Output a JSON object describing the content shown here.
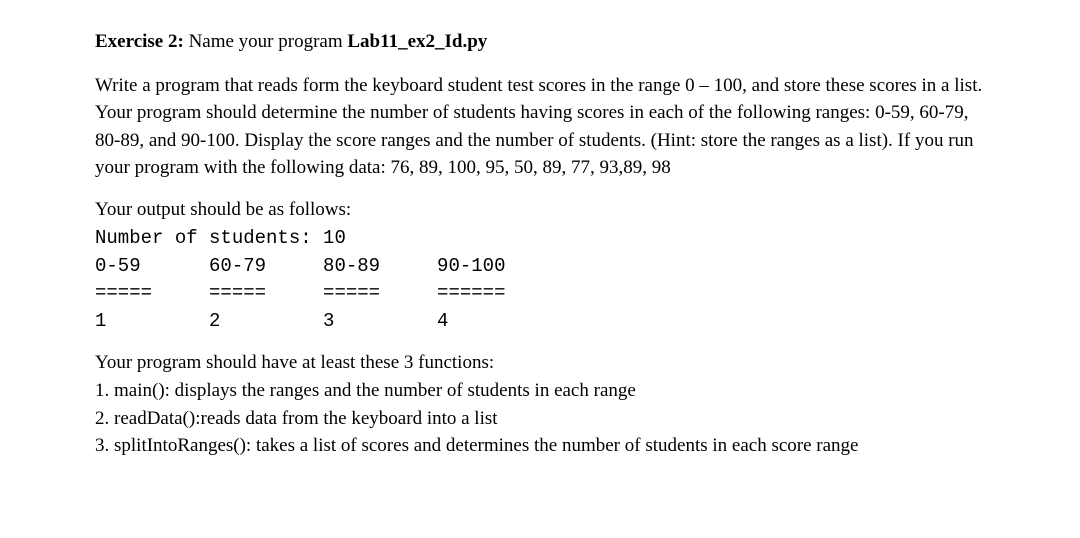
{
  "heading": {
    "prefix": "Exercise 2:",
    "mid": " Name your program ",
    "filename": "Lab11_ex2_Id.py"
  },
  "paragraph1": "Write a program that reads form the keyboard student test scores in the range 0 – 100, and store these scores in a list. Your program should determine the number of students having scores in each of the following ranges: 0-59, 60-79, 80-89, and 90-100. Display the score ranges and the number of students. (Hint: store the ranges as a list). If you run your program with the following data: 76, 89, 100, 95, 50, 89, 77, 93,89, 98",
  "output_intro": "Your output should be as follows:",
  "output_block": "Number of students: 10\n0-59      60-79     80-89     90-100\n=====     =====     =====     ======\n1         2         3         4",
  "functions_intro": "Your program should have at least these 3 functions:",
  "functions": {
    "f1": "1. main(): displays the ranges and the number of students in each range",
    "f2": "2. readData():reads data from the keyboard into a list",
    "f3": "3. splitIntoRanges(): takes a list of scores and determines the number of students in each score range"
  }
}
